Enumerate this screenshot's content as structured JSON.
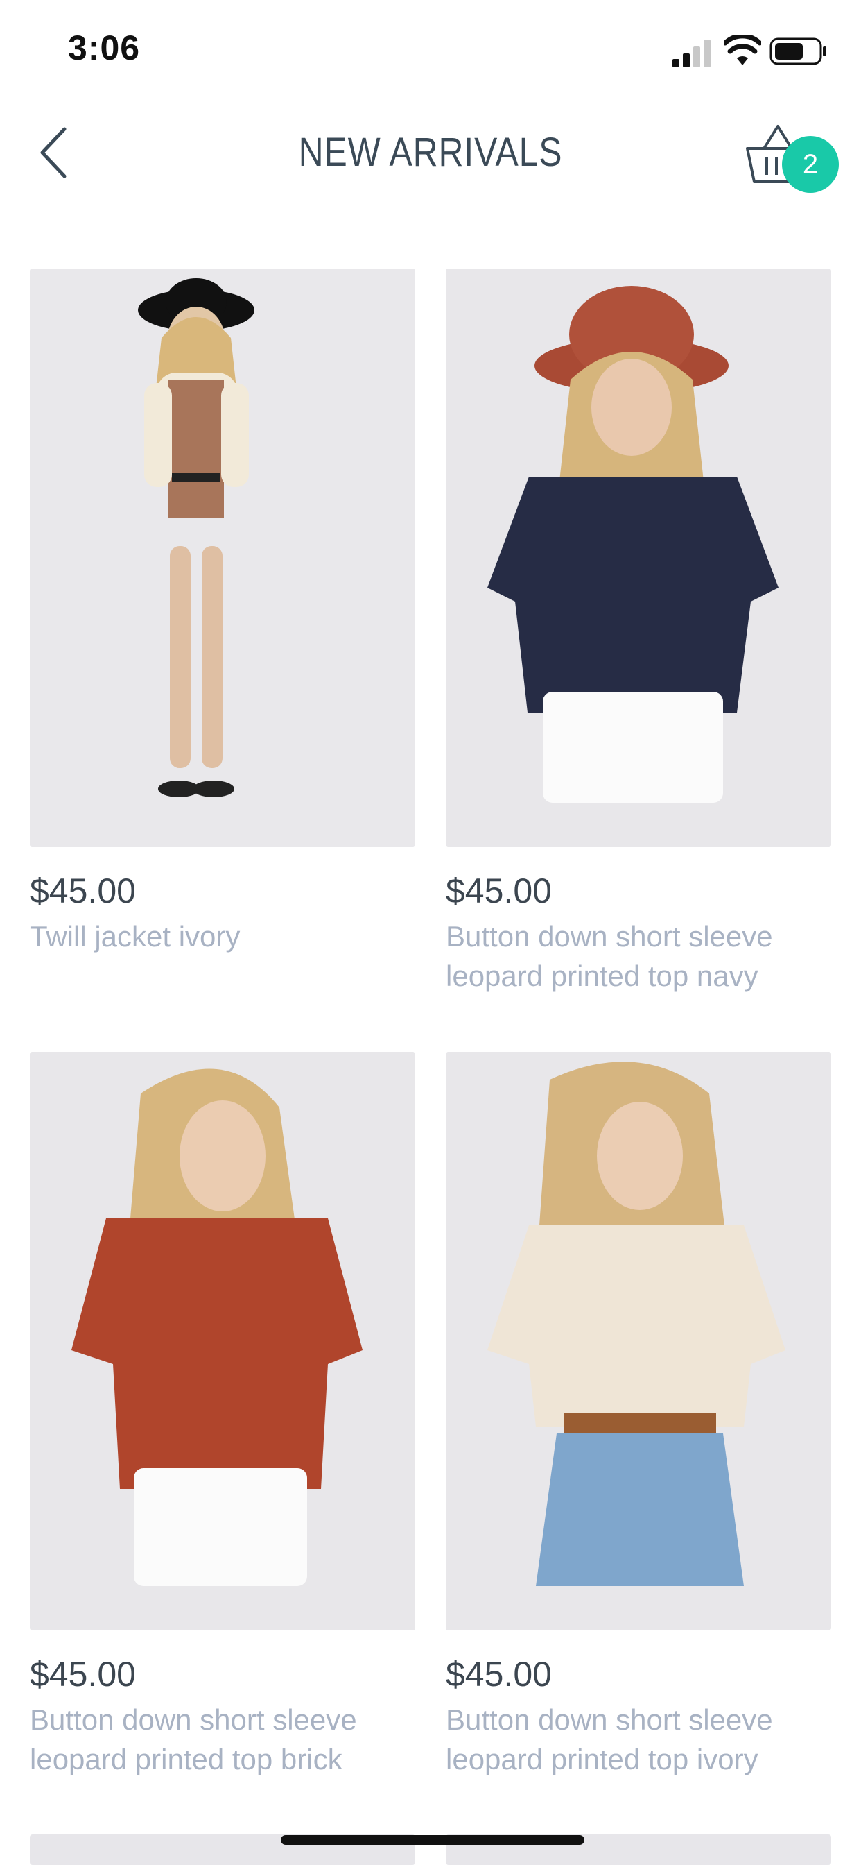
{
  "status_bar": {
    "time": "3:06"
  },
  "header": {
    "title": "NEW ARRIVALS",
    "cart_count": "2"
  },
  "products": [
    {
      "price": "$45.00",
      "name": "Twill jacket ivory"
    },
    {
      "price": "$45.00",
      "name": "Button down short sleeve leopard printed top navy"
    },
    {
      "price": "$45.00",
      "name": "Button down short sleeve leopard printed top brick"
    },
    {
      "price": "$45.00",
      "name": "Button down short sleeve leopard printed top ivory"
    }
  ],
  "colors": {
    "accent": "#19c9a8",
    "title": "#3b4a57",
    "price": "#3c4650",
    "product_name": "#a8b2c3"
  }
}
